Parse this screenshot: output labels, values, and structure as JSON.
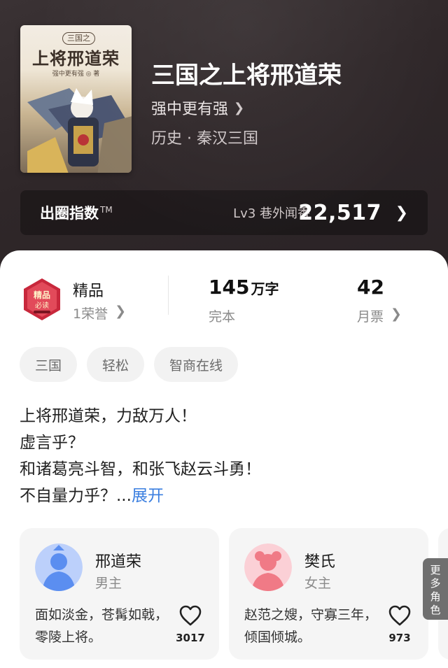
{
  "book": {
    "cover_series_badge": "三国之",
    "cover_title": "上将邢道荣",
    "cover_author": "强中更有强 ◎ 著",
    "title": "三国之上将邢道荣",
    "author": "强中更有强",
    "genre": "历史 · 秦汉三国"
  },
  "popularity": {
    "label": "出圈指数",
    "tm": "TM",
    "level": "Lv3 巷外闻香",
    "value": "22,517"
  },
  "stats": {
    "quality_label": "精品",
    "honors": "1荣誉",
    "word_count_num": "145",
    "word_count_unit": "万字",
    "status": "完本",
    "monthly_tickets": "42",
    "monthly_tickets_label": "月票"
  },
  "tags": [
    "三国",
    "轻松",
    "智商在线"
  ],
  "intro": {
    "lines": [
      "上将邢道荣，力敌万人！",
      "虚言乎？",
      "和诸葛亮斗智，和张飞赵云斗勇！",
      "不自量力乎？..."
    ],
    "expand": "展开"
  },
  "characters": [
    {
      "name": "邢道荣",
      "role": "男主",
      "desc": "面如淡金，苍髯如戟，零陵上将。",
      "likes": "3017",
      "avatar_color": "#5b8ef0"
    },
    {
      "name": "樊氏",
      "role": "女主",
      "desc": "赵范之嫂，守寡三年，倾国倾城。",
      "likes": "973",
      "avatar_color": "#f07a86"
    }
  ],
  "more_roles": "更多角色",
  "colors": {
    "link_blue": "#3b7fe0",
    "badge_red": "#c8283c"
  }
}
